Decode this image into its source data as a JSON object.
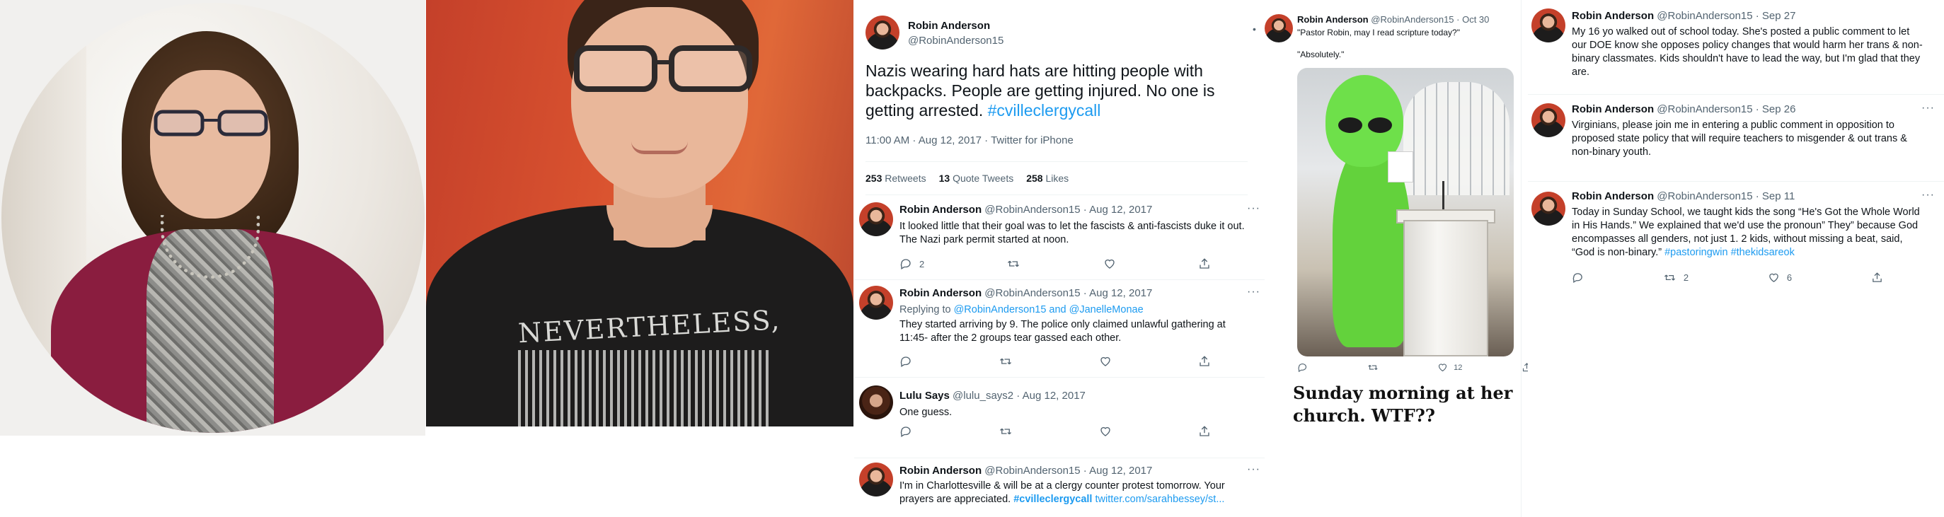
{
  "colors": {
    "link": "#1d9bf0",
    "text": "#0f1419",
    "secondary": "#536471",
    "divider": "#eff3f4"
  },
  "icons": [
    "reply-icon",
    "retweet-icon",
    "like-icon",
    "share-icon",
    "more-icon"
  ],
  "photo_2": {
    "shirt_text": "NEVERTHELESS,"
  },
  "main_tweet": {
    "name": "Robin Anderson",
    "handle": "@RobinAnderson15",
    "text": "Nazis wearing hard hats are hitting people with backpacks. People are getting injured. No one is getting arrested.",
    "hashtag": "#cvilleclergycall",
    "meta": "11:00 AM · Aug 12, 2017 · Twitter for iPhone",
    "retweets": "253",
    "retweets_label": "Retweets",
    "quotes": "13",
    "quotes_label": "Quote Tweets",
    "likes": "258",
    "likes_label": "Likes"
  },
  "replies": [
    {
      "name": "Robin Anderson",
      "handle_date": "@RobinAnderson15 · Aug 12, 2017",
      "text": "It looked little that their goal was to let the fascists & anti-fascists duke it out. The Nazi park permit started at noon.",
      "reply_count": "2"
    },
    {
      "name": "Robin Anderson",
      "handle_date": "@RobinAnderson15 · Aug 12, 2017",
      "replying_prefix": "Replying to",
      "replying_to": "@RobinAnderson15 and @JanelleMonae",
      "text": "They started arriving by 9. The police only claimed unlawful gathering at 11:45- after the 2 groups tear gassed each other."
    },
    {
      "name": "Lulu Says",
      "handle_date": "@lulu_says2 · Aug 12, 2017",
      "text": "One guess."
    },
    {
      "name": "Robin Anderson",
      "handle_date": "@RobinAnderson15 · Aug 12, 2017",
      "text": "I'm in Charlottesville & will be at a clergy counter protest tomorrow. Your prayers are appreciated.",
      "hashtag": "#cvilleclergycall",
      "link": "twitter.com/sarahbessey/st..."
    }
  ],
  "church_tweet": {
    "name": "Robin Anderson",
    "handle_date": "@RobinAnderson15 · Oct 30",
    "quote_1": "\"Pastor Robin, may I read scripture today?\"",
    "quote_2": "\"Absolutely.\"",
    "like_count": "12",
    "caption": "Sunday morning at her church.  WTF??"
  },
  "right_tweets": [
    {
      "name": "Robin Anderson",
      "handle_date": "@RobinAnderson15 · Sep 27",
      "text": "My 16 yo walked out of school today. She's posted a public comment to let our DOE know she opposes policy changes that would harm her trans & non-binary classmates. Kids shouldn't have to lead the way, but I'm glad that they are."
    },
    {
      "name": "Robin Anderson",
      "handle_date": "@RobinAnderson15 · Sep 26",
      "text": "Virginians, please join me in entering a public comment in opposition to proposed state policy that will require teachers to misgender & out trans & non-binary youth."
    },
    {
      "name": "Robin Anderson",
      "handle_date": "@RobinAnderson15 · Sep 11",
      "text": "Today in Sunday School, we taught kids the song “He's Got the Whole World in His Hands.” We explained that we'd use the pronoun” They” because God encompasses all genders, not just 1. 2 kids, without missing a beat, said, “God is non-binary.”",
      "hashtags": "#pastoringwin #thekidsareok",
      "retweet_count": "2",
      "like_count": "6"
    }
  ]
}
